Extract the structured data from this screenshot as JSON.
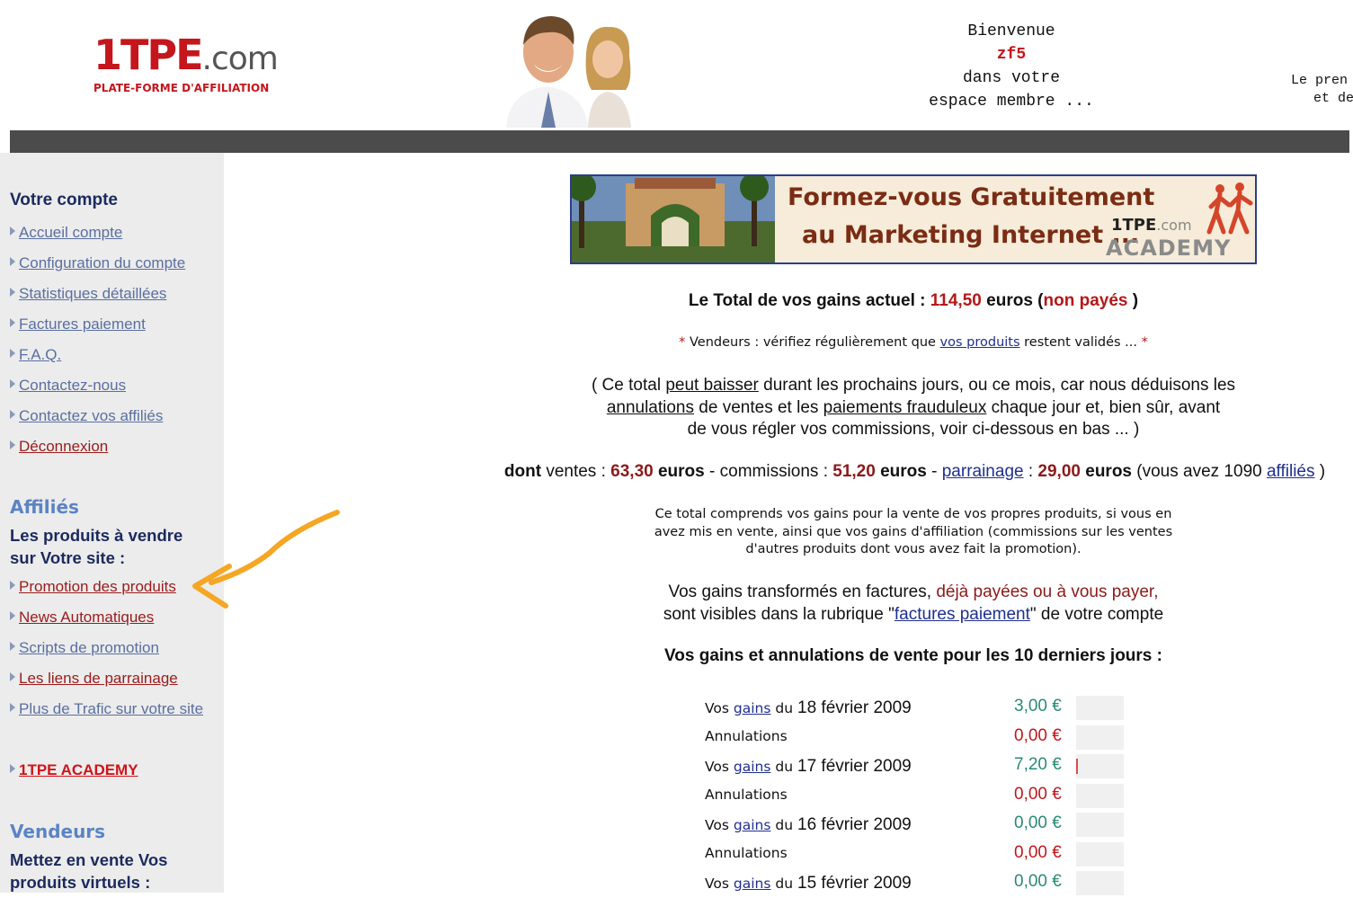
{
  "header": {
    "logo_main": "1TPE",
    "logo_domain": ".com",
    "logo_subtitle": "PLATE-FORME D'AFFILIATION",
    "welcome_line1": "Bienvenue",
    "welcome_user": "zf5",
    "welcome_line3": "dans votre",
    "welcome_line4": "espace membre ...",
    "tagline_line1": "Le pren",
    "tagline_line2": "et de"
  },
  "sidebar": {
    "account_title": "Votre compte",
    "account_links": [
      {
        "label": "Accueil compte"
      },
      {
        "label": "Configuration du compte"
      },
      {
        "label": "Statistiques détaillées"
      },
      {
        "label": "Factures paiement"
      },
      {
        "label": "F.A.Q."
      },
      {
        "label": "Contactez-nous"
      },
      {
        "label": "Contactez vos affiliés"
      },
      {
        "label": "Déconnexion"
      }
    ],
    "affiliates_title": "Affiliés",
    "affiliates_subtitle_1": "Les produits à vendre",
    "affiliates_subtitle_2": "sur Votre site :",
    "affiliate_links": [
      {
        "label": "Promotion des produits"
      },
      {
        "label": "News Automatiques"
      },
      {
        "label": "Scripts de promotion"
      },
      {
        "label": "Les liens de parrainage"
      },
      {
        "label": "Plus de Trafic sur votre site"
      }
    ],
    "academy_link": "1TPE ACADEMY",
    "vendors_title": "Vendeurs",
    "vendors_subtitle_1": "Mettez en vente Vos",
    "vendors_subtitle_2": "produits virtuels :"
  },
  "banner": {
    "line1": "Formez-vous Gratuitement",
    "line2": "au Marketing Internet ...",
    "brand": "1TPE",
    "brand_domain": ".com",
    "academy": "ACADEMY"
  },
  "summary": {
    "total_label": "Le Total de vos gains actuel :",
    "total_value": "114,50",
    "total_unit": "euros (",
    "total_status": "non payés",
    "total_close": ")",
    "vendors_star": "*",
    "vendors_text": "Vendeurs : vérifiez régulièrement que",
    "vendors_link": "vos produits",
    "vendors_tail": "restent validés ...",
    "paren_1a": "( Ce total",
    "paren_1b": "peut baisser",
    "paren_1c": "durant les prochains jours, ou ce mois, car nous déduisons les",
    "paren_2a": "annulations",
    "paren_2b": "de ventes et les",
    "paren_2c": "paiements frauduleux",
    "paren_2d": "chaque jour et, bien sûr, avant",
    "paren_3": "de vous régler vos commissions, voir ci-dessous en bas ... )",
    "dont_label": "dont",
    "ventes_label": "ventes :",
    "ventes_value": "63,30",
    "euros": "euros",
    "commissions_label": "- commissions :",
    "commissions_value": "51,20",
    "parrainage_link": "parrainage",
    "parrainage_value": "29,00",
    "affiliates_text": "(vous avez 1090",
    "affiliates_link": "affiliés",
    "explain_1": "Ce total comprends vos gains pour la vente de vos propres produits, si vous en",
    "explain_2": "avez mis en vente, ainsi que vos gains d'affiliation (commissions sur les ventes",
    "explain_3": "d'autres produits dont vous avez fait la promotion).",
    "factures_1a": "Vos gains transformés en factures,",
    "factures_1b": "déjà payées ou à vous payer,",
    "factures_2a": "sont visibles dans la rubrique \"",
    "factures_2b": "factures paiement",
    "factures_2c": "\" de votre compte",
    "table_title": "Vos gains et annulations de vente pour les 10 derniers jours :"
  },
  "gains_rows": [
    {
      "kind": "gain",
      "prefix": "Vos",
      "link": "gains",
      "mid": "du",
      "date": "18 février 2009",
      "amount": "3,00 €",
      "bar": 0
    },
    {
      "kind": "cancel",
      "prefix": "Annulations",
      "amount": "0,00 €",
      "bar": 0
    },
    {
      "kind": "gain",
      "prefix": "Vos",
      "link": "gains",
      "mid": "du",
      "date": "17 février 2009",
      "amount": "7,20 €",
      "bar": 1
    },
    {
      "kind": "cancel",
      "prefix": "Annulations",
      "amount": "0,00 €",
      "bar": 0
    },
    {
      "kind": "gain",
      "prefix": "Vos",
      "link": "gains",
      "mid": "du",
      "date": "16 février 2009",
      "amount": "0,00 €",
      "bar": 0
    },
    {
      "kind": "cancel",
      "prefix": "Annulations",
      "amount": "0,00 €",
      "bar": 0
    },
    {
      "kind": "gain",
      "prefix": "Vos",
      "link": "gains",
      "mid": "du",
      "date": "15 février 2009",
      "amount": "0,00 €",
      "bar": 0
    }
  ],
  "colors": {
    "accent_red": "#c4161c",
    "link_blue": "#1f2f8e",
    "gain_green": "#2a8a76",
    "arrow_orange": "#f5a623"
  }
}
